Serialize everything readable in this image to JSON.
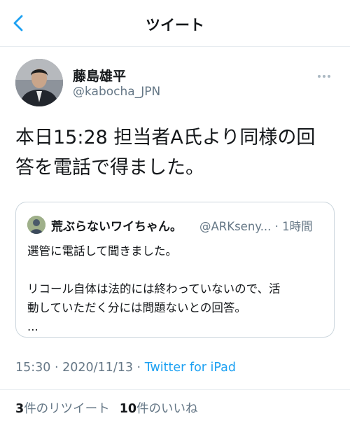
{
  "header": {
    "title": "ツイート",
    "back_icon": "chevron-left-icon",
    "accent": "#1da1f2"
  },
  "tweet": {
    "author_name": "藤島雄平",
    "author_handle": "@kabocha_JPN",
    "text_line1": "本日15:28 担当者A氏より同様の回",
    "text_line2": "答を電話で得ました。",
    "timestamp": "15:30 · 2020/11/13 · ",
    "source": "Twitter for iPad"
  },
  "quote": {
    "name": "荒ぶらないワイちゃん。",
    "handle_time": "@ARKseny... · 1時間",
    "line1": "選管に電話して聞きました。",
    "line2": "リコール自体は法的には終わっていないので、活",
    "line3": "動していただく分には問題ないとの回答。",
    "line4": "..."
  },
  "stats": {
    "retweets_count": "3",
    "retweets_label": "件のリツイート",
    "likes_count": "10",
    "likes_label": "件のいいね"
  }
}
